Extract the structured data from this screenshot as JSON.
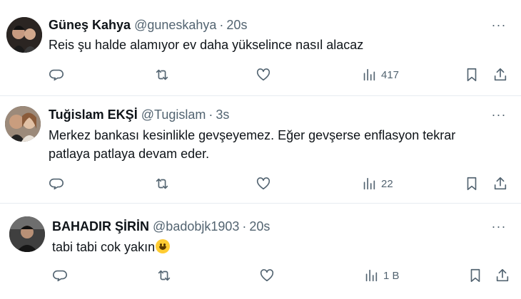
{
  "tweets": [
    {
      "name": "Güneş Kahya",
      "handle": "@guneskahya",
      "separator": "·",
      "time": "20s",
      "text": "Reis şu halde alamıyor ev daha yükselince nasıl alacaz",
      "views": "417",
      "avatar_colors": [
        "#3b2f2a",
        "#caa08a"
      ]
    },
    {
      "name": "Tuğislam EKŞİ",
      "handle": "@Tugislam",
      "separator": "·",
      "time": "3s",
      "text": "Merkez bankası kesinlikle gevşeyemez. Eğer gevşerse enflasyon tekrar\npatlaya patlaya devam eder.",
      "views": "22",
      "avatar_colors": [
        "#7a5a45",
        "#d8b89a"
      ]
    },
    {
      "name": "BAHADIR ŞİRİN",
      "handle": "@badobjk1903",
      "separator": "·",
      "time": "20s",
      "text": "tabi tabi cok yakın",
      "views": "1 B",
      "avatar_colors": [
        "#1e1e1e",
        "#6b6b6b"
      ]
    }
  ],
  "more_glyph": "···",
  "icons": [
    "reply-icon",
    "retweet-icon",
    "like-icon",
    "views-icon",
    "bookmark-icon",
    "share-icon"
  ],
  "colors": {
    "text": "#0f1419",
    "secondary": "#536471",
    "border": "#e6ecf0",
    "emoji": "#ffcc33"
  }
}
